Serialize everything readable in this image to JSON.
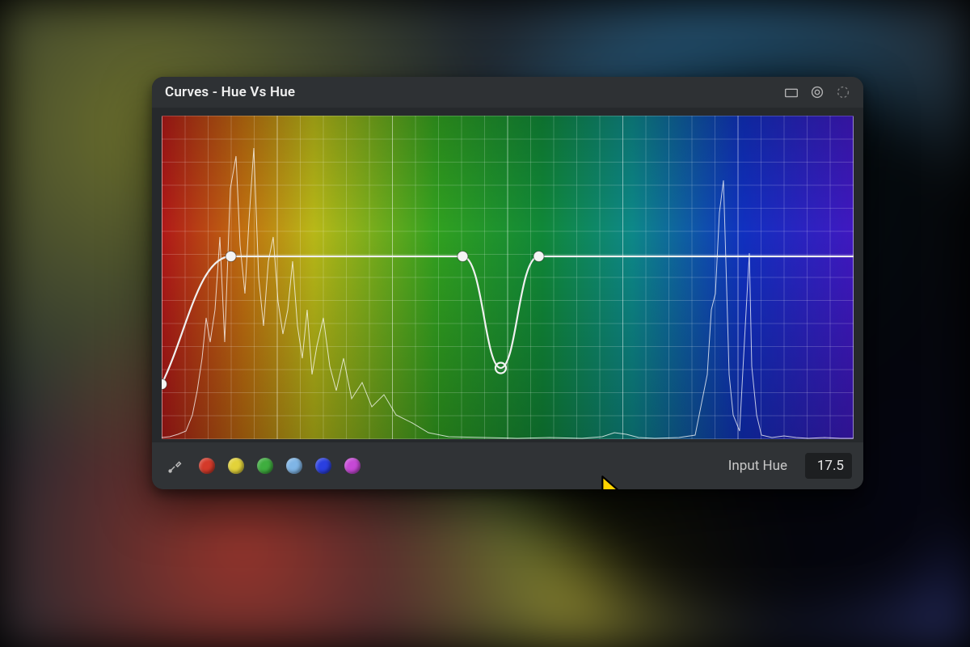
{
  "panel": {
    "title": "Curves - Hue Vs Hue"
  },
  "footer": {
    "input_label": "Input Hue",
    "input_value": "17.5"
  },
  "swatches": [
    {
      "name": "red",
      "color": "#d43a2a"
    },
    {
      "name": "yellow",
      "color": "#e2d23a"
    },
    {
      "name": "green",
      "color": "#3fae3f"
    },
    {
      "name": "cyan",
      "color": "#7fb5e6"
    },
    {
      "name": "blue",
      "color": "#2a3fe0"
    },
    {
      "name": "magenta",
      "color": "#c648d6"
    }
  ],
  "curve": {
    "points": [
      {
        "x": 0.0,
        "y": 0.83,
        "selected": false
      },
      {
        "x": 0.1,
        "y": 0.435,
        "selected": false
      },
      {
        "x": 0.435,
        "y": 0.435,
        "selected": false
      },
      {
        "x": 0.49,
        "y": 0.78,
        "selected": true
      },
      {
        "x": 0.545,
        "y": 0.435,
        "selected": false
      }
    ]
  },
  "icons": {
    "preset": "preset-icon",
    "reset": "reset-icon",
    "options": "options-icon"
  }
}
